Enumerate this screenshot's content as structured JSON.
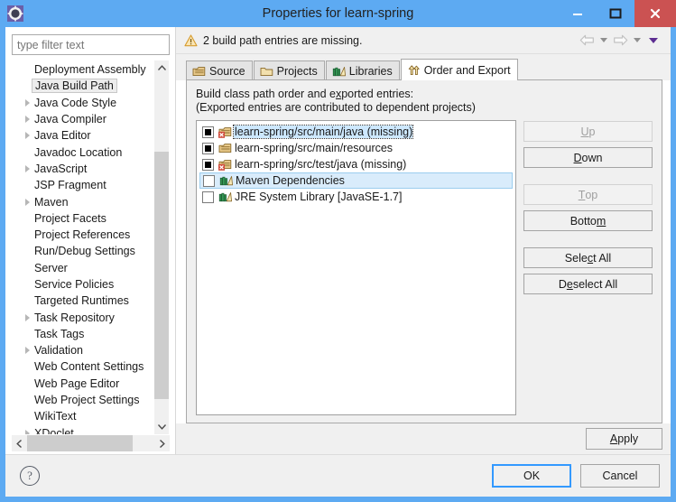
{
  "window": {
    "title": "Properties for learn-spring",
    "icon": "gear-icon",
    "minimize_label": "–",
    "maximize_label": "❐",
    "close_label": "✕"
  },
  "sidebar": {
    "filter": {
      "placeholder": "type filter text",
      "value": ""
    },
    "items": [
      {
        "label": "Deployment Assembly",
        "expandable": false,
        "selected": false
      },
      {
        "label": "Java Build Path",
        "expandable": false,
        "selected": true
      },
      {
        "label": "Java Code Style",
        "expandable": true,
        "selected": false
      },
      {
        "label": "Java Compiler",
        "expandable": true,
        "selected": false
      },
      {
        "label": "Java Editor",
        "expandable": true,
        "selected": false
      },
      {
        "label": "Javadoc Location",
        "expandable": false,
        "selected": false
      },
      {
        "label": "JavaScript",
        "expandable": true,
        "selected": false
      },
      {
        "label": "JSP Fragment",
        "expandable": false,
        "selected": false
      },
      {
        "label": "Maven",
        "expandable": true,
        "selected": false
      },
      {
        "label": "Project Facets",
        "expandable": false,
        "selected": false
      },
      {
        "label": "Project References",
        "expandable": false,
        "selected": false
      },
      {
        "label": "Run/Debug Settings",
        "expandable": false,
        "selected": false
      },
      {
        "label": "Server",
        "expandable": false,
        "selected": false
      },
      {
        "label": "Service Policies",
        "expandable": false,
        "selected": false
      },
      {
        "label": "Targeted Runtimes",
        "expandable": false,
        "selected": false
      },
      {
        "label": "Task Repository",
        "expandable": true,
        "selected": false
      },
      {
        "label": "Task Tags",
        "expandable": false,
        "selected": false
      },
      {
        "label": "Validation",
        "expandable": true,
        "selected": false
      },
      {
        "label": "Web Content Settings",
        "expandable": false,
        "selected": false
      },
      {
        "label": "Web Page Editor",
        "expandable": false,
        "selected": false
      },
      {
        "label": "Web Project Settings",
        "expandable": false,
        "selected": false
      },
      {
        "label": "WikiText",
        "expandable": false,
        "selected": false
      },
      {
        "label": "XDoclet",
        "expandable": true,
        "selected": false
      }
    ]
  },
  "message_bar": {
    "icon": "warning-icon",
    "text": "2 build path entries are missing.",
    "nav": {
      "back_icon": "arrow-left-icon",
      "back_menu_icon": "chevron-down-icon",
      "forward_icon": "arrow-right-icon",
      "forward_menu_icon": "chevron-down-icon",
      "view_menu_icon": "chevron-down-purple-icon"
    }
  },
  "tabs": [
    {
      "label": "Source",
      "icon": "source-folder-icon",
      "active": false
    },
    {
      "label": "Projects",
      "icon": "projects-folder-icon",
      "active": false
    },
    {
      "label": "Libraries",
      "icon": "libraries-books-icon",
      "active": false
    },
    {
      "label": "Order and Export",
      "icon": "order-export-icon",
      "active": true
    }
  ],
  "panel": {
    "heading_pre": "Build class path order and e",
    "heading_mnemonic": "x",
    "heading_post": "ported entries:",
    "subheading": "(Exported entries are contributed to dependent projects)",
    "entries": [
      {
        "label": "learn-spring/src/main/java (missing)",
        "checked": true,
        "icon": "source-folder-missing-icon",
        "focused": true,
        "highlighted": false
      },
      {
        "label": "learn-spring/src/main/resources",
        "checked": true,
        "icon": "source-folder-icon",
        "focused": false,
        "highlighted": false
      },
      {
        "label": "learn-spring/src/test/java (missing)",
        "checked": true,
        "icon": "source-folder-missing-icon",
        "focused": false,
        "highlighted": false
      },
      {
        "label": "Maven Dependencies",
        "checked": false,
        "icon": "libraries-books-icon",
        "focused": false,
        "highlighted": true
      },
      {
        "label": "JRE System Library [JavaSE-1.7]",
        "checked": false,
        "icon": "libraries-books-icon",
        "focused": false,
        "highlighted": false
      }
    ],
    "buttons": [
      {
        "pre": "",
        "mn": "U",
        "post": "p",
        "name": "up-button",
        "disabled": true
      },
      {
        "pre": "",
        "mn": "D",
        "post": "own",
        "name": "down-button",
        "disabled": false
      },
      {
        "pre": "",
        "mn": "T",
        "post": "op",
        "name": "top-button",
        "disabled": true
      },
      {
        "pre": "Botto",
        "mn": "m",
        "post": "",
        "name": "bottom-button",
        "disabled": false
      },
      {
        "pre": "Sele",
        "mn": "c",
        "post": "t All",
        "name": "select-all-button",
        "disabled": false
      },
      {
        "pre": "D",
        "mn": "e",
        "post": "select All",
        "name": "deselect-all-button",
        "disabled": false
      }
    ]
  },
  "apply": {
    "pre": "",
    "mn": "A",
    "post": "pply"
  },
  "footer": {
    "help_icon": "question-mark-icon",
    "help_label": "?",
    "ok_label": "OK",
    "cancel_label": "Cancel"
  },
  "colors": {
    "titlebar": "#5daaf2",
    "close_button": "#cb5252",
    "accent_focus": "#3399ff",
    "selection": "#cde8ff",
    "row_highlight": "#d9ecfb",
    "warning": "#e8b04a",
    "purple": "#5c2d91"
  }
}
